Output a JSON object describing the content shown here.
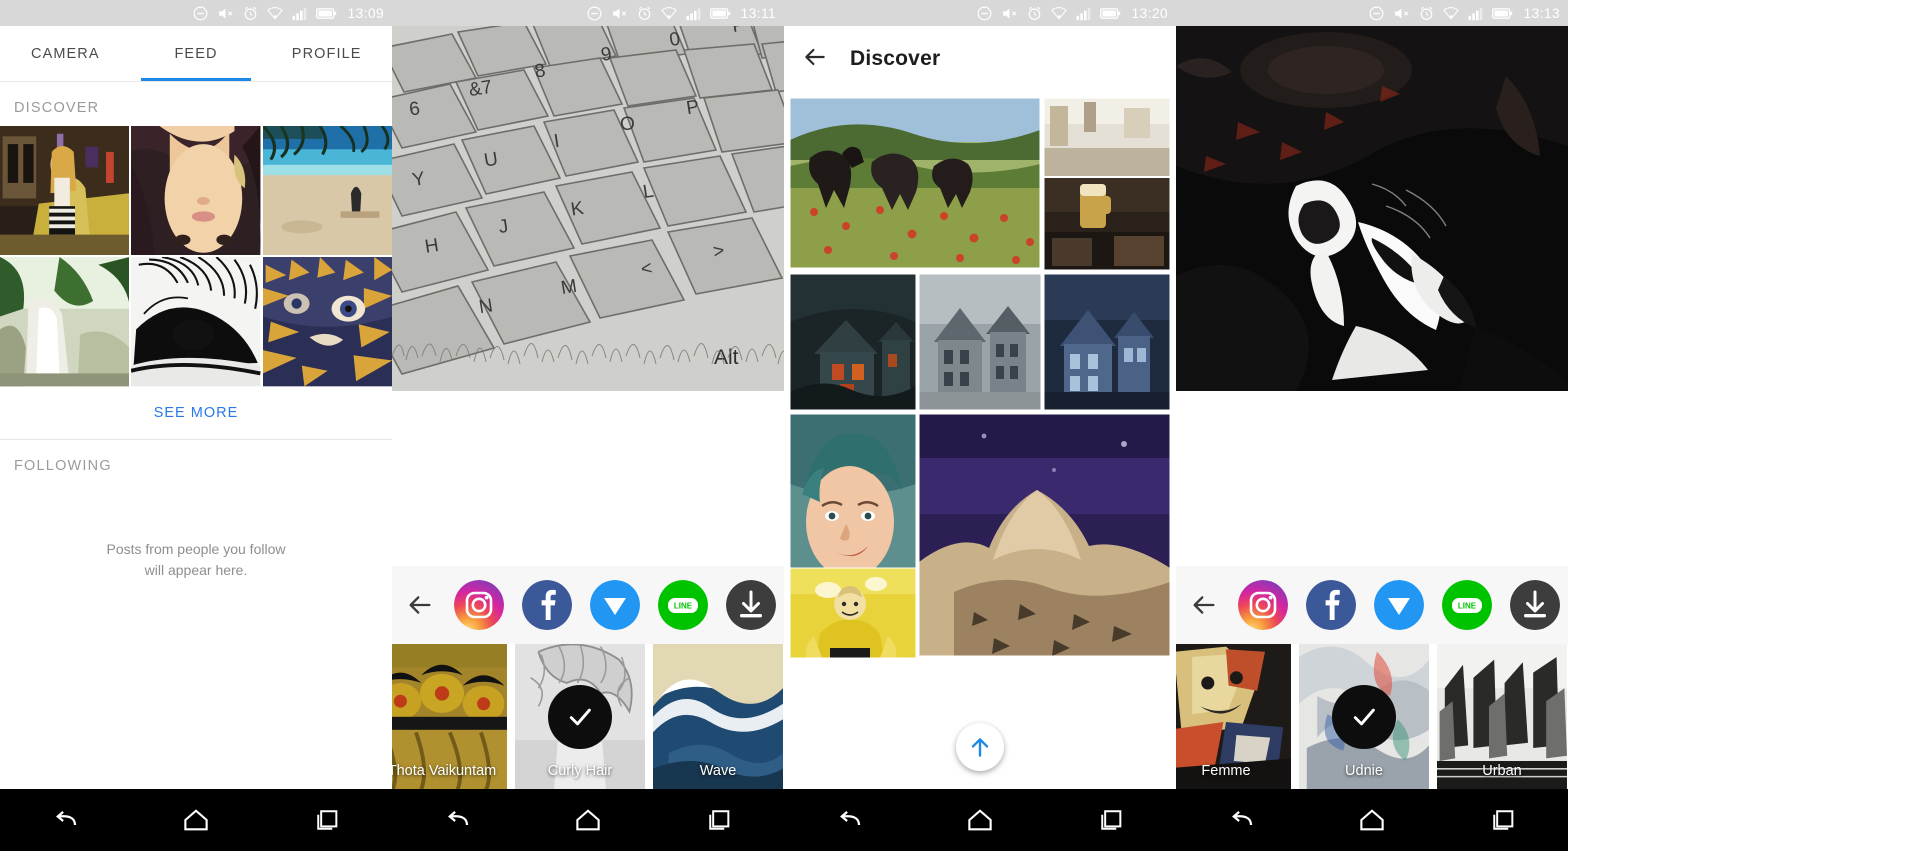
{
  "panels": [
    {
      "id": "feed-panel",
      "statusbar": {
        "time": "13:09",
        "icons": [
          "dnd-icon",
          "mute-icon",
          "alarm-icon",
          "wifi-icon",
          "signal-icon",
          "battery-icon"
        ]
      },
      "tabs": [
        {
          "label": "CAMERA",
          "active": false
        },
        {
          "label": "FEED",
          "active": true
        },
        {
          "label": "PROFILE",
          "active": false
        }
      ],
      "sections": [
        {
          "heading": "DISCOVER"
        },
        {
          "heading": "FOLLOWING"
        }
      ],
      "see_more_label": "SEE MORE",
      "empty_message_line1": "Posts from people you follow",
      "empty_message_line2": "will appear here.",
      "discover_tiles": [
        "woman-by-yellow-car",
        "overhead-portrait",
        "tropical-beach",
        "jungle-waterfall",
        "spiral-staircase",
        "leopard-face"
      ]
    },
    {
      "id": "share-keyboard-panel",
      "statusbar": {
        "time": "13:11",
        "icons": [
          "dnd-icon",
          "mute-icon",
          "alarm-icon",
          "wifi-icon",
          "signal-icon",
          "battery-icon"
        ]
      },
      "photo": "pencil-sketch-keyboard",
      "share_targets": [
        {
          "name": "instagram",
          "label": "Instagram",
          "color": "#d6249f"
        },
        {
          "name": "facebook",
          "label": "Facebook",
          "color": "#3b5998"
        },
        {
          "name": "messenger",
          "label": "Messenger",
          "color": "#2196f3"
        },
        {
          "name": "line",
          "label": "LINE",
          "color": "#00c300",
          "text": "LINE"
        },
        {
          "name": "download",
          "label": "Save",
          "color": "#3d3d3d"
        }
      ],
      "back_label": "Back",
      "filters": [
        {
          "label": "Thota Vaikuntam",
          "selected": false
        },
        {
          "label": "Curly Hair",
          "selected": true
        },
        {
          "label": "Wave",
          "selected": false
        }
      ]
    },
    {
      "id": "discover-panel",
      "statusbar": {
        "time": "13:20",
        "icons": [
          "dnd-icon",
          "mute-icon",
          "alarm-icon",
          "wifi-icon",
          "signal-icon",
          "battery-icon"
        ]
      },
      "title": "Discover",
      "back_label": "Back",
      "scroll_up_label": "Scroll to top",
      "mosaic_tiles": [
        "poppy-field-horses",
        "pub-interior",
        "haunted-house-red",
        "gothic-mansion",
        "victorian-house-blue",
        "woman-portrait-comic",
        "volcano-night",
        "yellow-strongman"
      ]
    },
    {
      "id": "share-cave-panel",
      "statusbar": {
        "time": "13:13",
        "icons": [
          "dnd-icon",
          "mute-icon",
          "alarm-icon",
          "wifi-icon",
          "signal-icon",
          "battery-icon"
        ]
      },
      "photo": "dark-cave-waterfall",
      "share_targets": [
        {
          "name": "instagram",
          "label": "Instagram",
          "color": "#d6249f"
        },
        {
          "name": "facebook",
          "label": "Facebook",
          "color": "#3b5998"
        },
        {
          "name": "messenger",
          "label": "Messenger",
          "color": "#2196f3"
        },
        {
          "name": "line",
          "label": "LINE",
          "color": "#00c300",
          "text": "LINE"
        },
        {
          "name": "download",
          "label": "Save",
          "color": "#3d3d3d"
        }
      ],
      "back_label": "Back",
      "filters": [
        {
          "label": "Femme",
          "selected": false
        },
        {
          "label": "Udnie",
          "selected": true
        },
        {
          "label": "Urban",
          "selected": false
        }
      ]
    }
  ],
  "navbar": {
    "back_label": "Back",
    "home_label": "Home",
    "recents_label": "Recent apps"
  },
  "colors": {
    "accent": "#1e88e5",
    "link": "#2979e8",
    "statusbar_bg": "#d8d8d8",
    "navbar_bg": "#000000",
    "section_label": "#9b9b9b"
  }
}
